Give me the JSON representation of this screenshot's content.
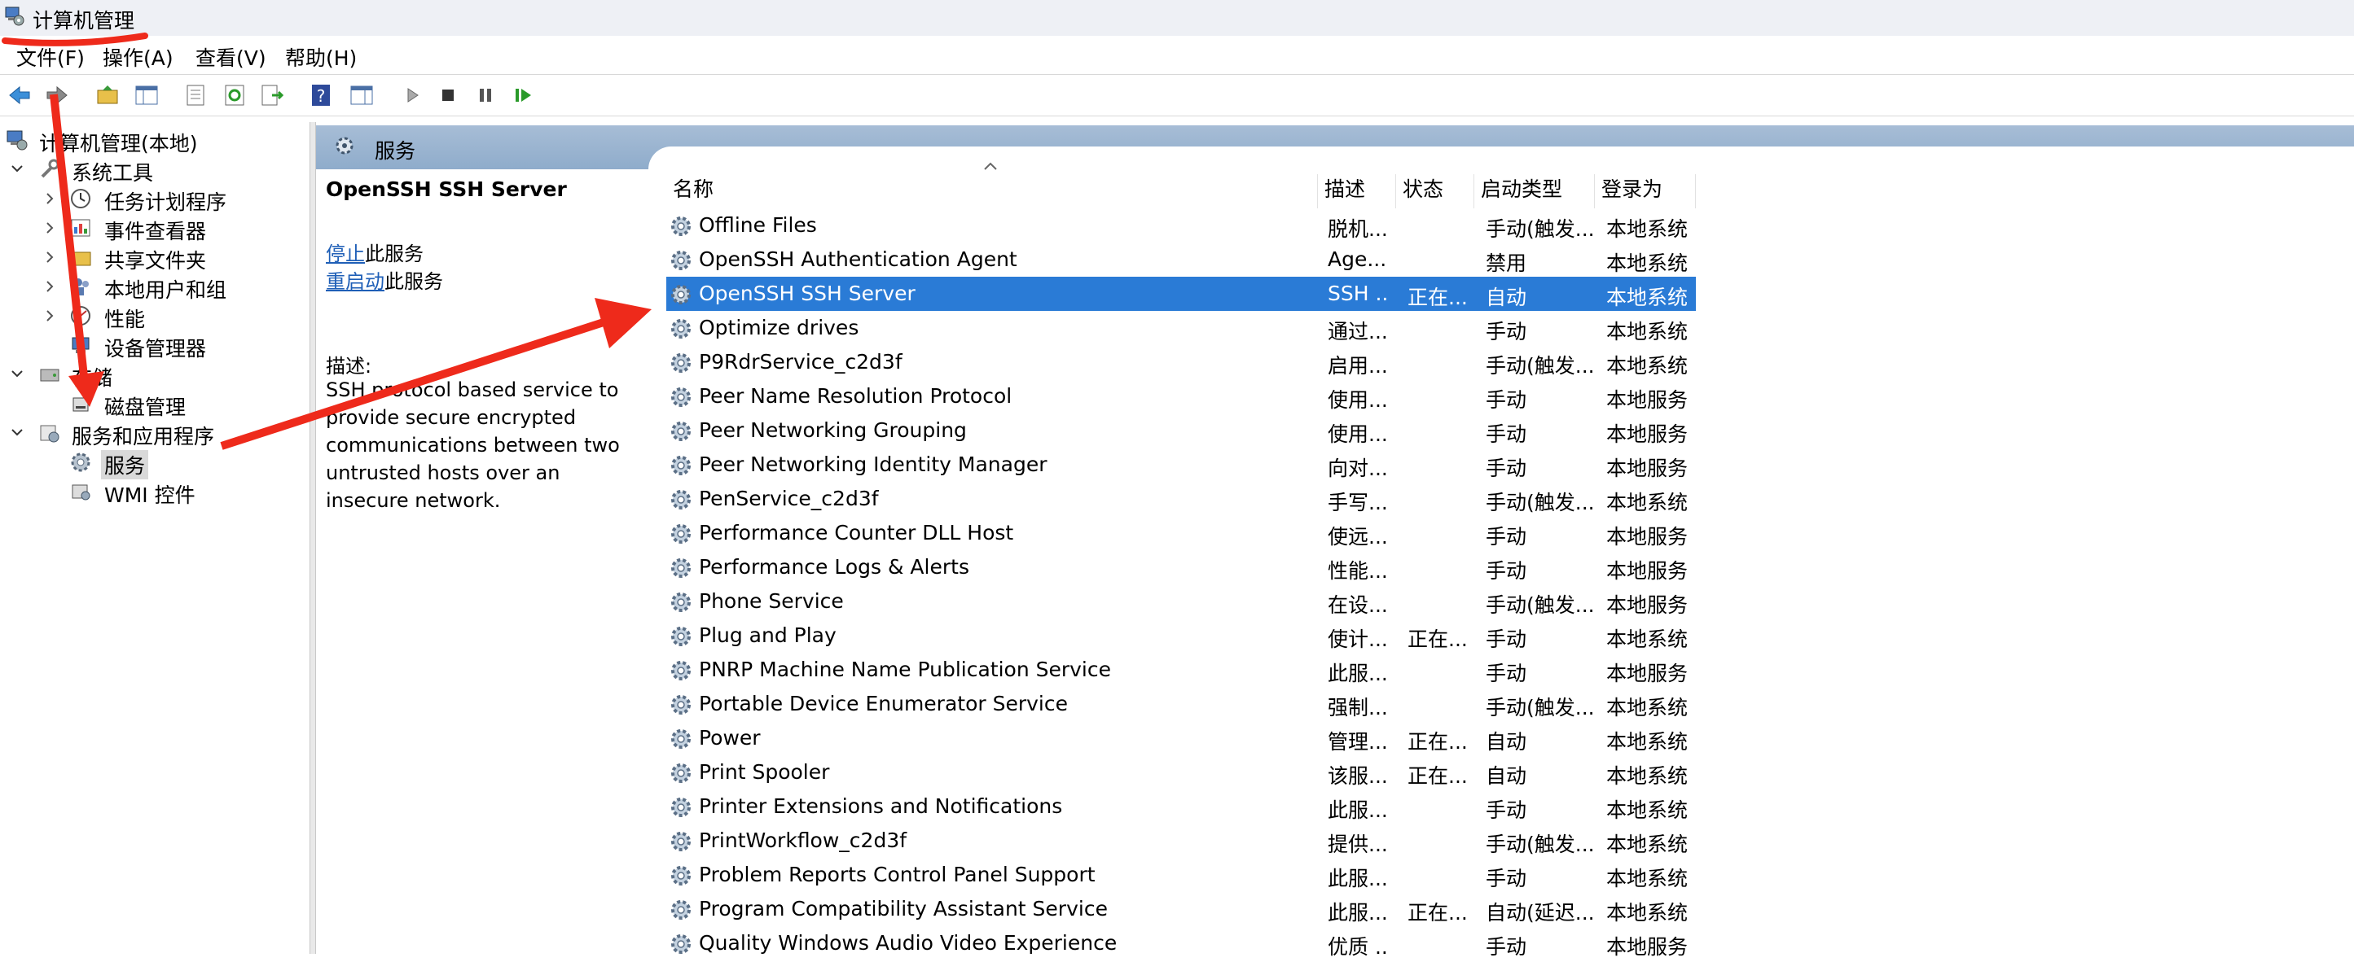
{
  "window": {
    "title": "计算机管理"
  },
  "menu": [
    "文件(F)",
    "操作(A)",
    "查看(V)",
    "帮助(H)"
  ],
  "tree": {
    "root": "计算机管理(本地)",
    "system_tools": "系统工具",
    "task_scheduler": "任务计划程序",
    "event_viewer": "事件查看器",
    "shared_folders": "共享文件夹",
    "local_users": "本地用户和组",
    "performance": "性能",
    "device_manager": "设备管理器",
    "storage": "存储",
    "disk_management": "磁盘管理",
    "services_apps": "服务和应用程序",
    "services": "服务",
    "wmi": "WMI 控件"
  },
  "header": {
    "title": "服务"
  },
  "detail": {
    "service_name": "OpenSSH SSH Server",
    "stop_link": "停止",
    "stop_suffix": "此服务",
    "restart_link": "重启动",
    "restart_suffix": "此服务",
    "desc_label": "描述:",
    "desc_text": "SSH protocol based service to provide secure encrypted communications between two untrusted hosts over an insecure network."
  },
  "columns": {
    "name": "名称",
    "desc": "描述",
    "status": "状态",
    "startup": "启动类型",
    "login": "登录为"
  },
  "services": [
    {
      "name": "Offline Files",
      "desc": "脱机...",
      "status": "",
      "startup": "手动(触发...",
      "login": "本地系统"
    },
    {
      "name": "OpenSSH Authentication Agent",
      "desc": "Age...",
      "status": "",
      "startup": "禁用",
      "login": "本地系统"
    },
    {
      "name": "OpenSSH SSH Server",
      "desc": "SSH ...",
      "status": "正在...",
      "startup": "自动",
      "login": "本地系统",
      "selected": true
    },
    {
      "name": "Optimize drives",
      "desc": "通过...",
      "status": "",
      "startup": "手动",
      "login": "本地系统"
    },
    {
      "name": "P9RdrService_c2d3f",
      "desc": "启用...",
      "status": "",
      "startup": "手动(触发...",
      "login": "本地系统"
    },
    {
      "name": "Peer Name Resolution Protocol",
      "desc": "使用...",
      "status": "",
      "startup": "手动",
      "login": "本地服务"
    },
    {
      "name": "Peer Networking Grouping",
      "desc": "使用...",
      "status": "",
      "startup": "手动",
      "login": "本地服务"
    },
    {
      "name": "Peer Networking Identity Manager",
      "desc": "向对...",
      "status": "",
      "startup": "手动",
      "login": "本地服务"
    },
    {
      "name": "PenService_c2d3f",
      "desc": "手写...",
      "status": "",
      "startup": "手动(触发...",
      "login": "本地系统"
    },
    {
      "name": "Performance Counter DLL Host",
      "desc": "使远...",
      "status": "",
      "startup": "手动",
      "login": "本地服务"
    },
    {
      "name": "Performance Logs & Alerts",
      "desc": "性能...",
      "status": "",
      "startup": "手动",
      "login": "本地服务"
    },
    {
      "name": "Phone Service",
      "desc": "在设...",
      "status": "",
      "startup": "手动(触发...",
      "login": "本地服务"
    },
    {
      "name": "Plug and Play",
      "desc": "使计...",
      "status": "正在...",
      "startup": "手动",
      "login": "本地系统"
    },
    {
      "name": "PNRP Machine Name Publication Service",
      "desc": "此服...",
      "status": "",
      "startup": "手动",
      "login": "本地服务"
    },
    {
      "name": "Portable Device Enumerator Service",
      "desc": "强制...",
      "status": "",
      "startup": "手动(触发...",
      "login": "本地系统"
    },
    {
      "name": "Power",
      "desc": "管理...",
      "status": "正在...",
      "startup": "自动",
      "login": "本地系统"
    },
    {
      "name": "Print Spooler",
      "desc": "该服...",
      "status": "正在...",
      "startup": "自动",
      "login": "本地系统"
    },
    {
      "name": "Printer Extensions and Notifications",
      "desc": "此服...",
      "status": "",
      "startup": "手动",
      "login": "本地系统"
    },
    {
      "name": "PrintWorkflow_c2d3f",
      "desc": "提供...",
      "status": "",
      "startup": "手动(触发...",
      "login": "本地系统"
    },
    {
      "name": "Problem Reports Control Panel Support",
      "desc": "此服...",
      "status": "",
      "startup": "手动",
      "login": "本地系统"
    },
    {
      "name": "Program Compatibility Assistant Service",
      "desc": "此服...",
      "status": "正在...",
      "startup": "自动(延迟...",
      "login": "本地系统"
    },
    {
      "name": "Quality Windows Audio Video Experience",
      "desc": "优质 ...",
      "status": "",
      "startup": "手动",
      "login": "本地服务"
    }
  ],
  "colors": {
    "selection": "#2a7bd6",
    "header_bar": "#8faccb",
    "annotation": "#ee2a1b",
    "link": "#1f5fb7"
  }
}
